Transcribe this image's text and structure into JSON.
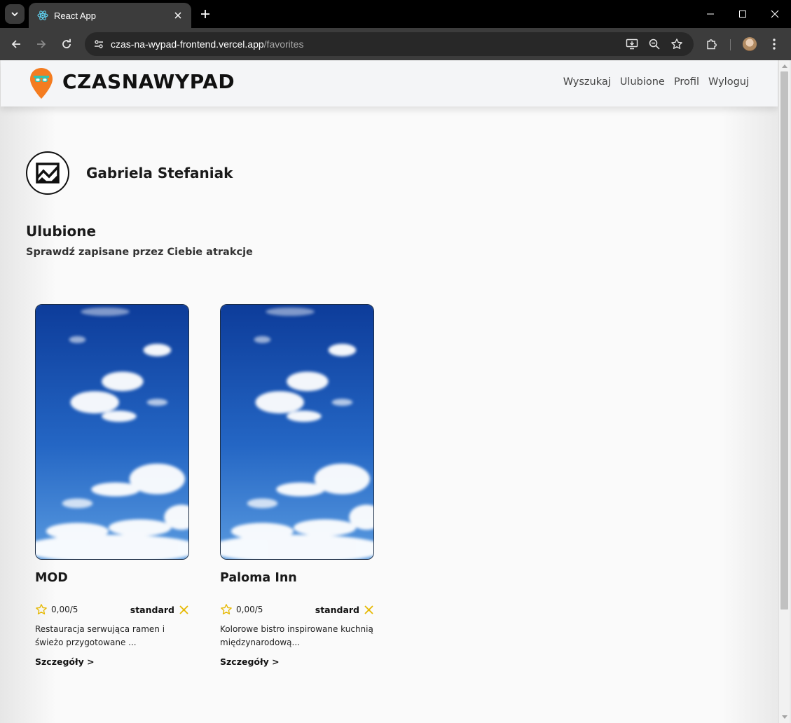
{
  "browser": {
    "tab_title": "React App",
    "url_host": "czas-na-wypad-frontend.vercel.app",
    "url_path": "/favorites",
    "icons": {
      "tab_search": "chevron-down-icon",
      "favicon": "react-logo-icon",
      "tab_close": "close-icon",
      "new_tab": "plus-icon",
      "back": "arrow-left-icon",
      "forward": "arrow-right-icon",
      "reload": "reload-icon",
      "site_info": "tune-icon",
      "install": "install-app-icon",
      "zoom": "zoom-out-icon",
      "bookmark": "star-icon",
      "extensions": "puzzle-icon",
      "profile": "profile-avatar-icon",
      "menu": "kebab-menu-icon"
    }
  },
  "header": {
    "logo_text": "CZASNAWYPAD",
    "nav": [
      "Wyszukaj",
      "Ulubione",
      "Profil",
      "Wyloguj"
    ]
  },
  "profile": {
    "name": "Gabriela Stefaniak",
    "avatar_icon": "image-placeholder-icon"
  },
  "section": {
    "title": "Ulubione",
    "subtitle": "Sprawdź zapisane przez Ciebie atrakcje"
  },
  "cards": [
    {
      "name": "MOD",
      "rating": "0,00/5",
      "tier": "standard",
      "description": "Restauracja serwująca ramen i świeżo przygotowane ...",
      "link": "Szczegóły >",
      "image": "sky-clouds-image"
    },
    {
      "name": "Paloma Inn",
      "rating": "0,00/5",
      "tier": "standard",
      "description": "Kolorowe bistro inspirowane kuchnią międzynarodową...",
      "link": "Szczegóły >",
      "image": "sky-clouds-image"
    }
  ],
  "colors": {
    "accent_orange": "#f47c20",
    "accent_teal": "#2fc4b2",
    "star_gold": "#e6b800",
    "sky_top": "#0d3c9a",
    "sky_bottom": "#5a9be0"
  }
}
